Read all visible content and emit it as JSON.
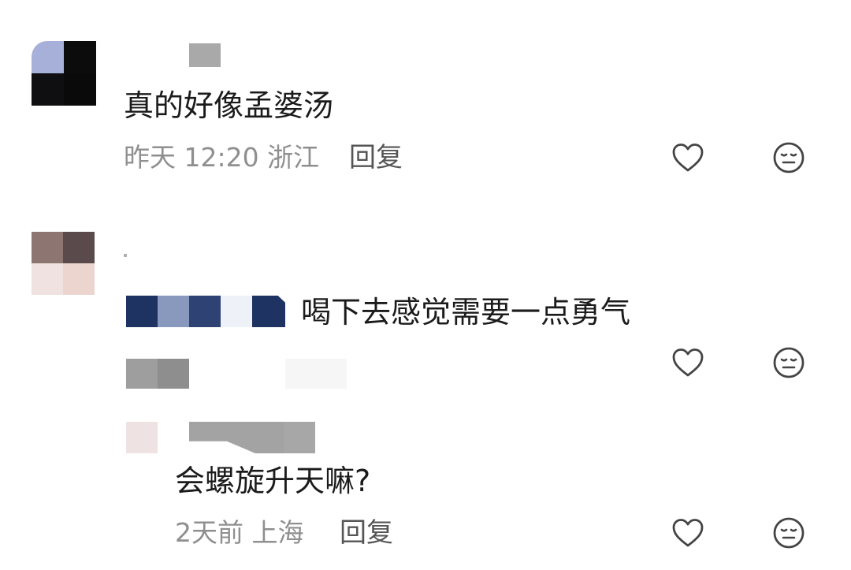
{
  "comments": [
    {
      "text": "真的好像孟婆汤",
      "time": "昨天 12:20",
      "location": "浙江",
      "reply_label": "回复"
    },
    {
      "text": "喝下去感觉需要一点勇气"
    }
  ],
  "replies": [
    {
      "text": "会螺旋升天嘛?",
      "time": "2天前",
      "location": "上海",
      "reply_label": "回复"
    }
  ],
  "icons": {
    "like": "heart-outline-icon",
    "dislike": "neutral-face-icon"
  },
  "colors": {
    "text": "#1b1b1b",
    "meta": "#8f8f8f",
    "icon": "#444444"
  }
}
